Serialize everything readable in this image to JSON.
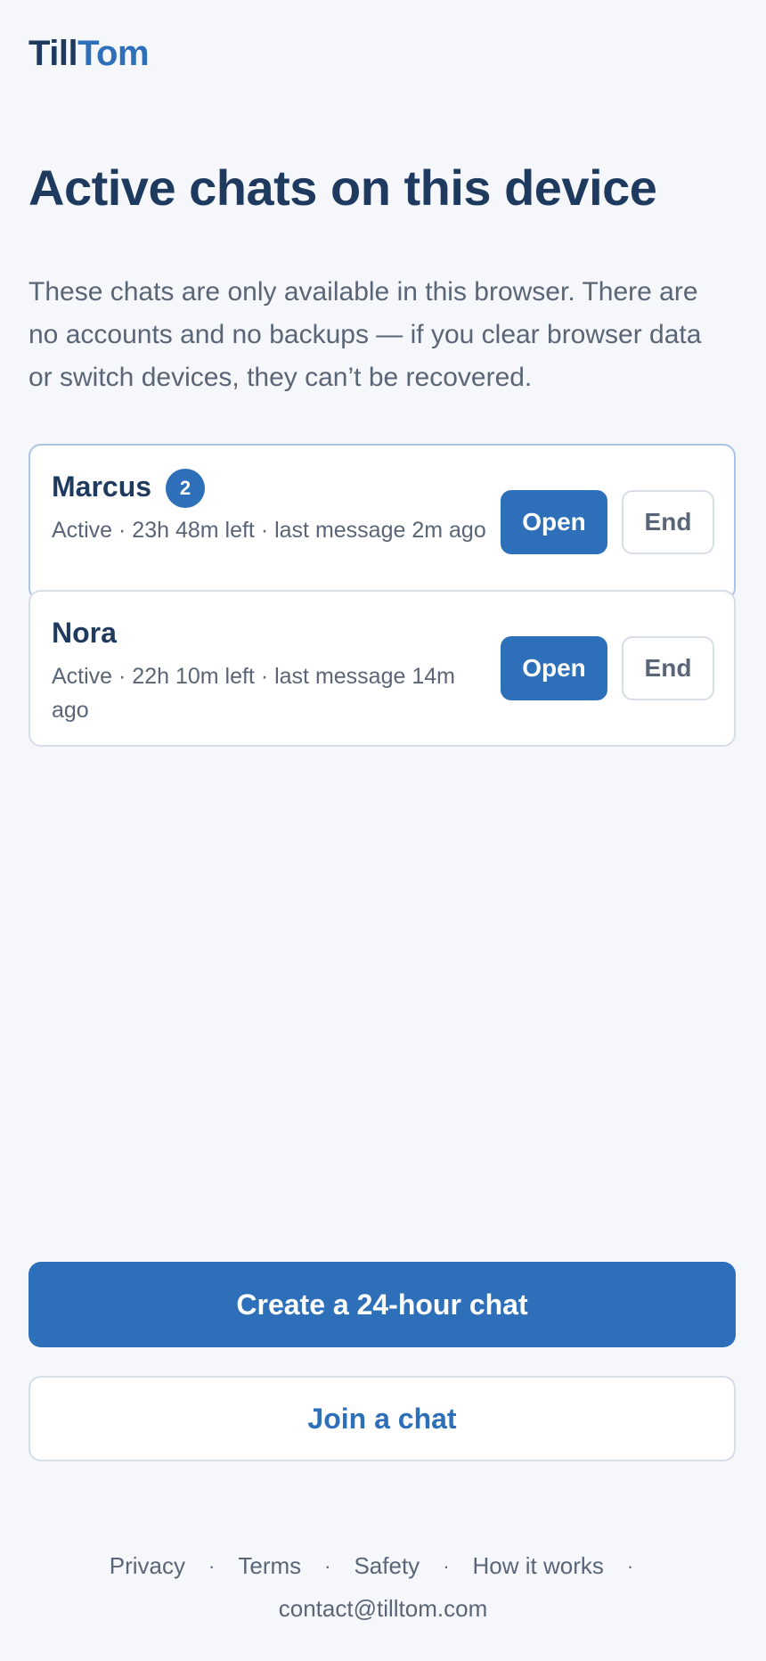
{
  "brand": {
    "part1": "Till",
    "part2": "Tom"
  },
  "page": {
    "title": "Active chats on this device",
    "description": "These chats are only available in this browser. There are no accounts and no backups — if you clear browser data or switch devices, they can’t be recovered."
  },
  "chats": [
    {
      "name": "Marcus",
      "unread": "2",
      "meta": "Active · 23h 48m left · last message 2m ago",
      "open_label": "Open",
      "end_label": "End"
    },
    {
      "name": "Nora",
      "meta": "Active · 22h 10m left · last message 14m ago",
      "open_label": "Open",
      "end_label": "End"
    }
  ],
  "actions": {
    "create_label": "Create a 24-hour chat",
    "join_label": "Join a chat"
  },
  "footer": {
    "links": [
      "Privacy",
      "Terms",
      "Safety",
      "How it works"
    ],
    "separator": "·",
    "email": "contact@tilltom.com"
  },
  "colors": {
    "accent": "#2e6fba",
    "heading": "#1f3a5f",
    "body_text": "#5a6577",
    "background": "#f5f7fb"
  }
}
